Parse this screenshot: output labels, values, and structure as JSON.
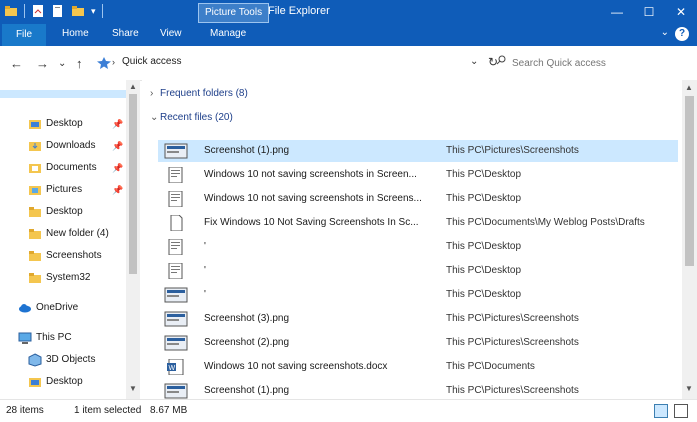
{
  "window": {
    "title": "File Explorer",
    "contextual_tab": "Picture Tools",
    "controls": {
      "minimize": "—",
      "maximize": "☐",
      "close": "✕"
    }
  },
  "ribbon": {
    "file": "File",
    "tabs": [
      "Home",
      "Share",
      "View",
      "Manage"
    ],
    "help": "?",
    "collapse": "⌄"
  },
  "address": {
    "back": "←",
    "forward": "→",
    "recent": "⌄",
    "up": "↑",
    "path": "Quick access",
    "dropdown": "⌄",
    "refresh": "↻",
    "search_placeholder": "Search Quick access"
  },
  "sidebar": {
    "quick_access": [
      {
        "label": "Desktop",
        "pinned": true,
        "icon": "desktop-folder-icon"
      },
      {
        "label": "Downloads",
        "pinned": true,
        "icon": "downloads-folder-icon"
      },
      {
        "label": "Documents",
        "pinned": true,
        "icon": "documents-folder-icon"
      },
      {
        "label": "Pictures",
        "pinned": true,
        "icon": "pictures-folder-icon"
      },
      {
        "label": "Desktop",
        "pinned": false,
        "icon": "folder-icon"
      },
      {
        "label": "New folder (4)",
        "pinned": false,
        "icon": "folder-icon"
      },
      {
        "label": "Screenshots",
        "pinned": false,
        "icon": "folder-icon"
      },
      {
        "label": "System32",
        "pinned": false,
        "icon": "folder-icon"
      }
    ],
    "onedrive": "OneDrive",
    "this_pc": "This PC",
    "this_pc_items": [
      {
        "label": "3D Objects",
        "icon": "3d-objects-icon"
      },
      {
        "label": "Desktop",
        "icon": "desktop-folder-icon"
      }
    ],
    "pin_glyph": "📌"
  },
  "groups": {
    "frequent": {
      "label": "Frequent folders (8)",
      "expanded": false
    },
    "recent": {
      "label": "Recent files (20)",
      "expanded": true
    }
  },
  "files": [
    {
      "name": "Screenshot (1).png",
      "location": "This PC\\Pictures\\Screenshots",
      "icon": "image-thumbnail-icon",
      "selected": true
    },
    {
      "name": "Windows 10 not saving screenshots in Screen...",
      "location": "This PC\\Desktop",
      "icon": "document-thumbnail-icon",
      "selected": false
    },
    {
      "name": "Windows 10 not saving screenshots in Screens...",
      "location": "This PC\\Desktop",
      "icon": "document-thumbnail-icon",
      "selected": false
    },
    {
      "name": "Fix Windows 10 Not Saving Screenshots In Sc...",
      "location": "This PC\\Documents\\My Weblog Posts\\Drafts",
      "icon": "blank-document-icon",
      "selected": false
    },
    {
      "name": "'",
      "location": "This PC\\Desktop",
      "icon": "document-thumbnail-icon",
      "selected": false
    },
    {
      "name": "'",
      "location": "This PC\\Desktop",
      "icon": "document-thumbnail-icon",
      "selected": false
    },
    {
      "name": "'",
      "location": "This PC\\Desktop",
      "icon": "image-thumbnail-icon",
      "selected": false
    },
    {
      "name": "Screenshot (3).png",
      "location": "This PC\\Pictures\\Screenshots",
      "icon": "image-thumbnail-icon",
      "selected": false
    },
    {
      "name": "Screenshot (2).png",
      "location": "This PC\\Pictures\\Screenshots",
      "icon": "image-thumbnail-icon",
      "selected": false
    },
    {
      "name": "Windows 10 not saving screenshots.docx",
      "location": "This PC\\Documents",
      "icon": "word-document-icon",
      "selected": false
    },
    {
      "name": "Screenshot (1).png",
      "location": "This PC\\Pictures\\Screenshots",
      "icon": "image-thumbnail-icon",
      "selected": false
    }
  ],
  "status": {
    "count": "28 items",
    "selection": "1 item selected",
    "size": "8.67 MB"
  },
  "colors": {
    "titlebar": "#0f5cb8",
    "selection": "#cce8ff",
    "group_text": "#1e3f8a"
  }
}
